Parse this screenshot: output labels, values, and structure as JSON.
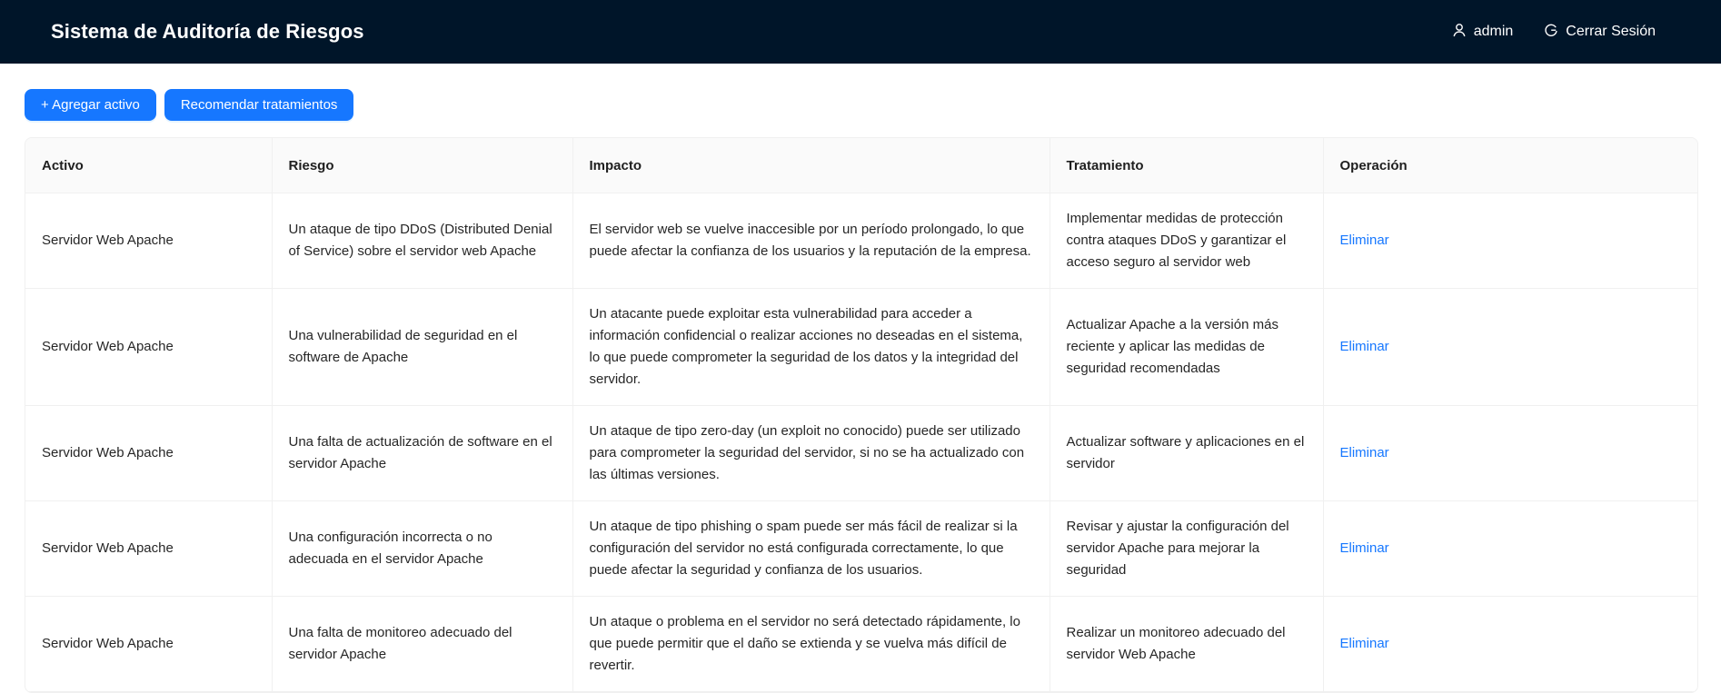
{
  "header": {
    "title": "Sistema de Auditoría de Riesgos",
    "user_icon": "user-icon",
    "user_label": "admin",
    "logout_icon": "logout-icon",
    "logout_label": "Cerrar Sesión"
  },
  "toolbar": {
    "add_asset_label": "+ Agregar activo",
    "recommend_label": "Recomendar tratamientos"
  },
  "table": {
    "columns": [
      "Activo",
      "Riesgo",
      "Impacto",
      "Tratamiento",
      "Operación"
    ],
    "rows": [
      {
        "activo": "Servidor Web Apache",
        "riesgo": "Un ataque de tipo DDoS (Distributed Denial of Service) sobre el servidor web Apache",
        "impacto": "El servidor web se vuelve inaccesible por un período prolongado, lo que puede afectar la confianza de los usuarios y la reputación de la empresa.",
        "tratamiento": "Implementar medidas de protección contra ataques DDoS y garantizar el acceso seguro al servidor web",
        "operacion": "Eliminar"
      },
      {
        "activo": "Servidor Web Apache",
        "riesgo": "Una vulnerabilidad de seguridad en el software de Apache",
        "impacto": "Un atacante puede exploitar esta vulnerabilidad para acceder a información confidencial o realizar acciones no deseadas en el sistema, lo que puede comprometer la seguridad de los datos y la integridad del servidor.",
        "tratamiento": "Actualizar Apache a la versión más reciente y aplicar las medidas de seguridad recomendadas",
        "operacion": "Eliminar"
      },
      {
        "activo": "Servidor Web Apache",
        "riesgo": "Una falta de actualización de software en el servidor Apache",
        "impacto": "Un ataque de tipo zero-day (un exploit no conocido) puede ser utilizado para comprometer la seguridad del servidor, si no se ha actualizado con las últimas versiones.",
        "tratamiento": "Actualizar software y aplicaciones en el servidor",
        "operacion": "Eliminar"
      },
      {
        "activo": "Servidor Web Apache",
        "riesgo": "Una configuración incorrecta o no adecuada en el servidor Apache",
        "impacto": "Un ataque de tipo phishing o spam puede ser más fácil de realizar si la configuración del servidor no está configurada correctamente, lo que puede afectar la seguridad y confianza de los usuarios.",
        "tratamiento": "Revisar y ajustar la configuración del servidor Apache para mejorar la seguridad",
        "operacion": "Eliminar"
      },
      {
        "activo": "Servidor Web Apache",
        "riesgo": "Una falta de monitoreo adecuado del servidor Apache",
        "impacto": "Un ataque o problema en el servidor no será detectado rápidamente, lo que puede permitir que el daño se extienda y se vuelva más difícil de revertir.",
        "tratamiento": "Realizar un monitoreo adecuado del servidor Web Apache",
        "operacion": "Eliminar"
      }
    ]
  },
  "colors": {
    "header_bg": "#001529",
    "primary": "#1677ff",
    "table_header_bg": "#fafafa",
    "border": "#f0f0f0"
  }
}
